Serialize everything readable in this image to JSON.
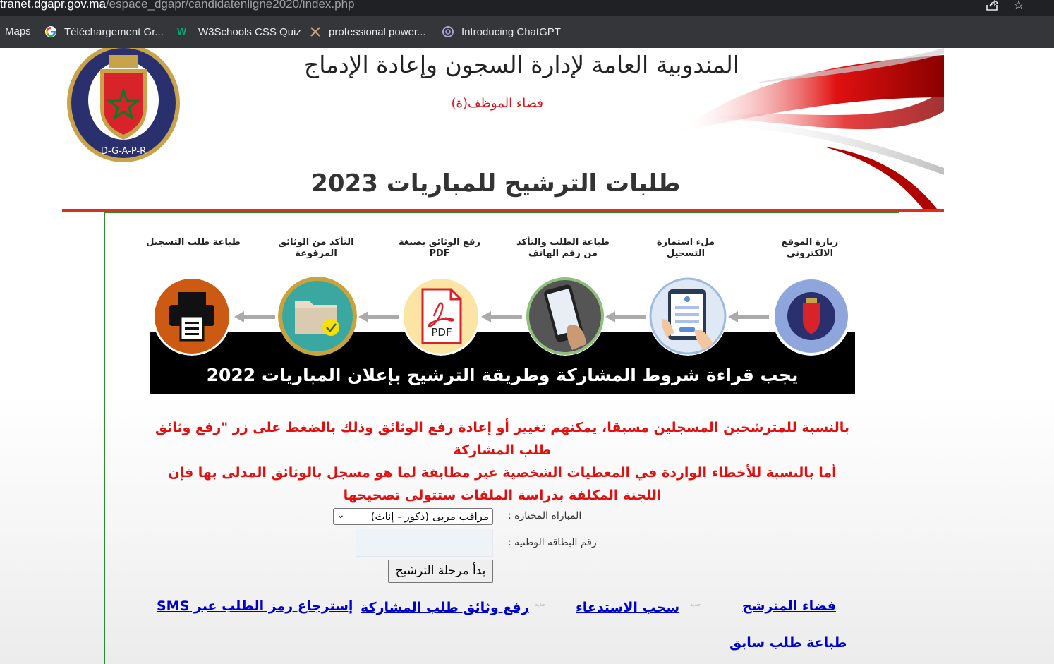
{
  "browser": {
    "url_host": "tranet.dgapr.gov.ma",
    "url_path": "/espace_dgapr/candidatenligne2020/index.php",
    "bookmarks": [
      {
        "label": "Maps",
        "icon": "maps-icon"
      },
      {
        "label": "Téléchargement Gr...",
        "icon": "google-icon"
      },
      {
        "label": "W3Schools CSS Quiz",
        "icon": "w3schools-icon"
      },
      {
        "label": "professional power...",
        "icon": "tools-icon"
      },
      {
        "label": "Introducing ChatGPT",
        "icon": "openai-icon"
      }
    ]
  },
  "header": {
    "title": "المندوبية العامة لإدارة السجون وإعادة الإدماج",
    "subtitle": "فضاء الموظف(ة)",
    "logo_text": "D-G-A-P-R",
    "main_title": "طلبات الترشيح للمباريات 2023"
  },
  "steps": {
    "caption": "يجب قراءة شروط المشاركة وطريقة الترشيح بإعلان المباريات 2022",
    "items": [
      {
        "label": "زيارة الموقع الالكتروني",
        "icon": "dgapr-logo-icon"
      },
      {
        "label": "ملء استمارة التسجيل",
        "icon": "tablet-form-icon"
      },
      {
        "label": "طباعة الطلب والتأكد من رقم الهاتف",
        "icon": "phone-icon"
      },
      {
        "label": "رفع الوثائق بصيغة PDF",
        "icon": "pdf-icon"
      },
      {
        "label": "التأكد من الوثائق المرفوعة",
        "icon": "folder-check-icon"
      },
      {
        "label": "طباعة طلب التسجيل",
        "icon": "printer-icon"
      }
    ],
    "pdf_text": "PDF"
  },
  "notice": {
    "line1": "بالنسبة للمترشحين المسجلين مسبقا، يمكنهم تغيير أو إعادة رفع الوثائق وذلك بالضغط على زر \"رفع وثائق طلب المشاركة",
    "line2": "أما بالنسبة للأخطاء الواردة في المعطيات الشخصية غير مطابقة لما هو مسجل بالوثائق المدلى بها فإن اللجنة المكلفة بدراسة الملفات ستتولى تصحيحها"
  },
  "form": {
    "competition_label": "المباراة المختارة :",
    "competition_value": "مراقب مربى (ذكور - إناث)",
    "cin_label": "رقم البطاقة الوطنية :",
    "cin_value": "",
    "start_button": "بدأ مرحلة الترشيح"
  },
  "links": {
    "candidate_space": "فضاء المترشح",
    "download_convocation": "سحب الاستدعاء",
    "upload_docs": "رفع وثائق طلب المشاركة",
    "recover_code": "إسترجاع رمز الطلب عبر SMS",
    "print_previous": "طباعة طلب سابق",
    "new_badge": "جديد"
  },
  "colors": {
    "accent_red": "#e22d1c",
    "notice_red": "#e01010",
    "link_blue": "#0000cc",
    "border_green": "#2e8a2e"
  }
}
